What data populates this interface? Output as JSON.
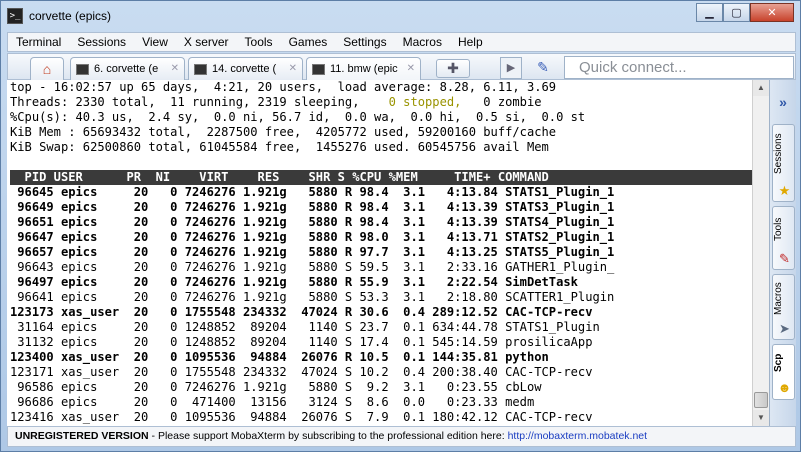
{
  "window": {
    "title": "corvette (epics)",
    "app_icon": "terminal-icon"
  },
  "menu": [
    "Terminal",
    "Sessions",
    "View",
    "X server",
    "Tools",
    "Games",
    "Settings",
    "Macros",
    "Help"
  ],
  "tabs": [
    {
      "label": "6. corvette (e",
      "icon": "terminal-icon"
    },
    {
      "label": "14. corvette (",
      "icon": "terminal-icon"
    },
    {
      "label": "11. bmw (epic",
      "icon": "terminal-icon"
    }
  ],
  "quick_connect": {
    "placeholder": "Quick connect..."
  },
  "terminal": {
    "summary": [
      "top - 16:02:57 up 65 days,  4:21, 20 users,  load average: 8.28, 6.11, 3.69",
      "Threads: 2330 total,  11 running, 2319 sleeping,",
      "%Cpu(s): 40.3 us,  2.4 sy,  0.0 ni, 56.7 id,  0.0 wa,  0.0 hi,  0.5 si,  0.0 st",
      "KiB Mem : 65693432 total,  2287500 free,  4205772 used, 59200160 buff/cache",
      "KiB Swap: 62500860 total, 61045584 free,  1455276 used. 60545756 avail Mem"
    ],
    "threads_stopped": "    0 stopped,",
    "threads_zombie": "   0 zombie",
    "header": "  PID USER      PR  NI    VIRT    RES    SHR S %CPU %MEM     TIME+ COMMAND           ",
    "rows": [
      {
        "text": " 96645 epics     20   0 7246276 1.921g   5880 R 98.4  3.1   4:13.84 STATS1_Plugin_1",
        "bold": true
      },
      {
        "text": " 96649 epics     20   0 7246276 1.921g   5880 R 98.4  3.1   4:13.39 STATS3_Plugin_1",
        "bold": true
      },
      {
        "text": " 96651 epics     20   0 7246276 1.921g   5880 R 98.4  3.1   4:13.39 STATS4_Plugin_1",
        "bold": true
      },
      {
        "text": " 96647 epics     20   0 7246276 1.921g   5880 R 98.0  3.1   4:13.71 STATS2_Plugin_1",
        "bold": true
      },
      {
        "text": " 96657 epics     20   0 7246276 1.921g   5880 R 97.7  3.1   4:13.25 STATS5_Plugin_1",
        "bold": true
      },
      {
        "text": " 96643 epics     20   0 7246276 1.921g   5880 S 59.5  3.1   2:33.16 GATHER1_Plugin_",
        "bold": false
      },
      {
        "text": " 96497 epics     20   0 7246276 1.921g   5880 R 55.9  3.1   2:22.54 SimDetTask",
        "bold": true
      },
      {
        "text": " 96641 epics     20   0 7246276 1.921g   5880 S 53.3  3.1   2:18.80 SCATTER1_Plugin",
        "bold": false
      },
      {
        "text": "123173 xas_user  20   0 1755548 234332  47024 R 30.6  0.4 289:12.52 CAC-TCP-recv",
        "bold": true
      },
      {
        "text": " 31164 epics     20   0 1248852  89204   1140 S 23.7  0.1 634:44.78 STATS1_Plugin",
        "bold": false
      },
      {
        "text": " 31132 epics     20   0 1248852  89204   1140 S 17.4  0.1 545:14.59 prosilicaApp",
        "bold": false
      },
      {
        "text": "123400 xas_user  20   0 1095536  94884  26076 R 10.5  0.1 144:35.81 python",
        "bold": true
      },
      {
        "text": "123171 xas_user  20   0 1755548 234332  47024 S 10.2  0.4 200:38.40 CAC-TCP-recv",
        "bold": false
      },
      {
        "text": " 96586 epics     20   0 7246276 1.921g   5880 S  9.2  3.1   0:23.55 cbLow",
        "bold": false
      },
      {
        "text": " 96686 epics     20   0  471400  13156   3124 S  8.6  0.0   0:23.33 medm",
        "bold": false
      },
      {
        "text": "123416 xas_user  20   0 1095536  94884  26076 S  7.9  0.1 180:42.12 CAC-TCP-recv",
        "bold": false
      }
    ]
  },
  "sidebar": {
    "collapse_icon": "double-chevron-right-icon",
    "tabs": [
      {
        "label": "Sessions",
        "icon": "star-icon"
      },
      {
        "label": "Tools",
        "icon": "wrench-icon"
      },
      {
        "label": "Macros",
        "icon": "paper-plane-icon"
      },
      {
        "label": "Scp",
        "icon": "smiley-icon"
      }
    ]
  },
  "status": {
    "bold_text": "UNREGISTERED VERSION",
    "message": "  -  Please support MobaXterm by subscribing to the professional edition here:  ",
    "link": "http://mobaxterm.mobatek.net"
  }
}
